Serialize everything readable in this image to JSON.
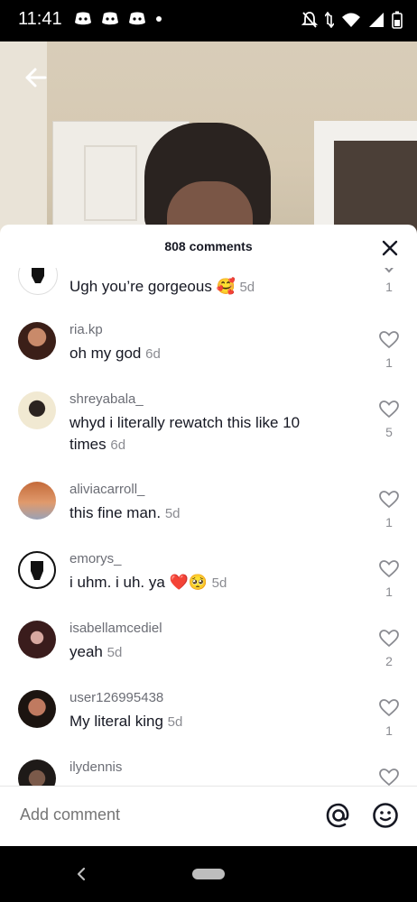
{
  "status_bar": {
    "time": "11:41",
    "notification_icons": [
      "discord-icon",
      "discord-icon",
      "discord-icon",
      "dot-icon"
    ],
    "right_icons": [
      "mute-icon",
      "data-icon",
      "wifi-icon",
      "signal-icon",
      "battery-icon"
    ]
  },
  "video": {
    "back_icon": "arrow-left-icon"
  },
  "sheet": {
    "title": "808 comments",
    "close_icon": "close-icon"
  },
  "comments": [
    {
      "username": "",
      "text": "Ugh you’re gorgeous 🥰",
      "time": "5d",
      "likes": "1",
      "avatar": "fist-icon"
    },
    {
      "username": "ria.kp",
      "text": "oh my god",
      "time": "6d",
      "likes": "1",
      "avatar": "avatar"
    },
    {
      "username": "shreyabala_",
      "text": "whyd i literally rewatch this like 10 times",
      "time": "6d",
      "likes": "5",
      "avatar": "avatar"
    },
    {
      "username": "aliviacarroll_",
      "text": "this fine man.",
      "time": "5d",
      "likes": "1",
      "avatar": "avatar"
    },
    {
      "username": "emorys_",
      "text": "i uhm. i uh. ya ❤️🥺",
      "time": "5d",
      "likes": "1",
      "avatar": "fist-icon"
    },
    {
      "username": "isabellamcediel",
      "text": "yeah",
      "time": "5d",
      "likes": "2",
      "avatar": "avatar"
    },
    {
      "username": "user126995438",
      "text": "My literal king",
      "time": "5d",
      "likes": "1",
      "avatar": "avatar"
    },
    {
      "username": "ilydennis",
      "text": "",
      "time": "",
      "likes": "",
      "avatar": "avatar"
    }
  ],
  "footer": {
    "placeholder": "Add comment",
    "at_icon": "at-icon",
    "emoji_icon": "emoji-icon"
  },
  "nav": {
    "back_icon": "nav-back-icon",
    "home_icon": "home-pill-icon"
  },
  "colors": {
    "text_primary": "#161823",
    "text_secondary": "#8a8b91",
    "heart_outline": "#8a8b91"
  }
}
